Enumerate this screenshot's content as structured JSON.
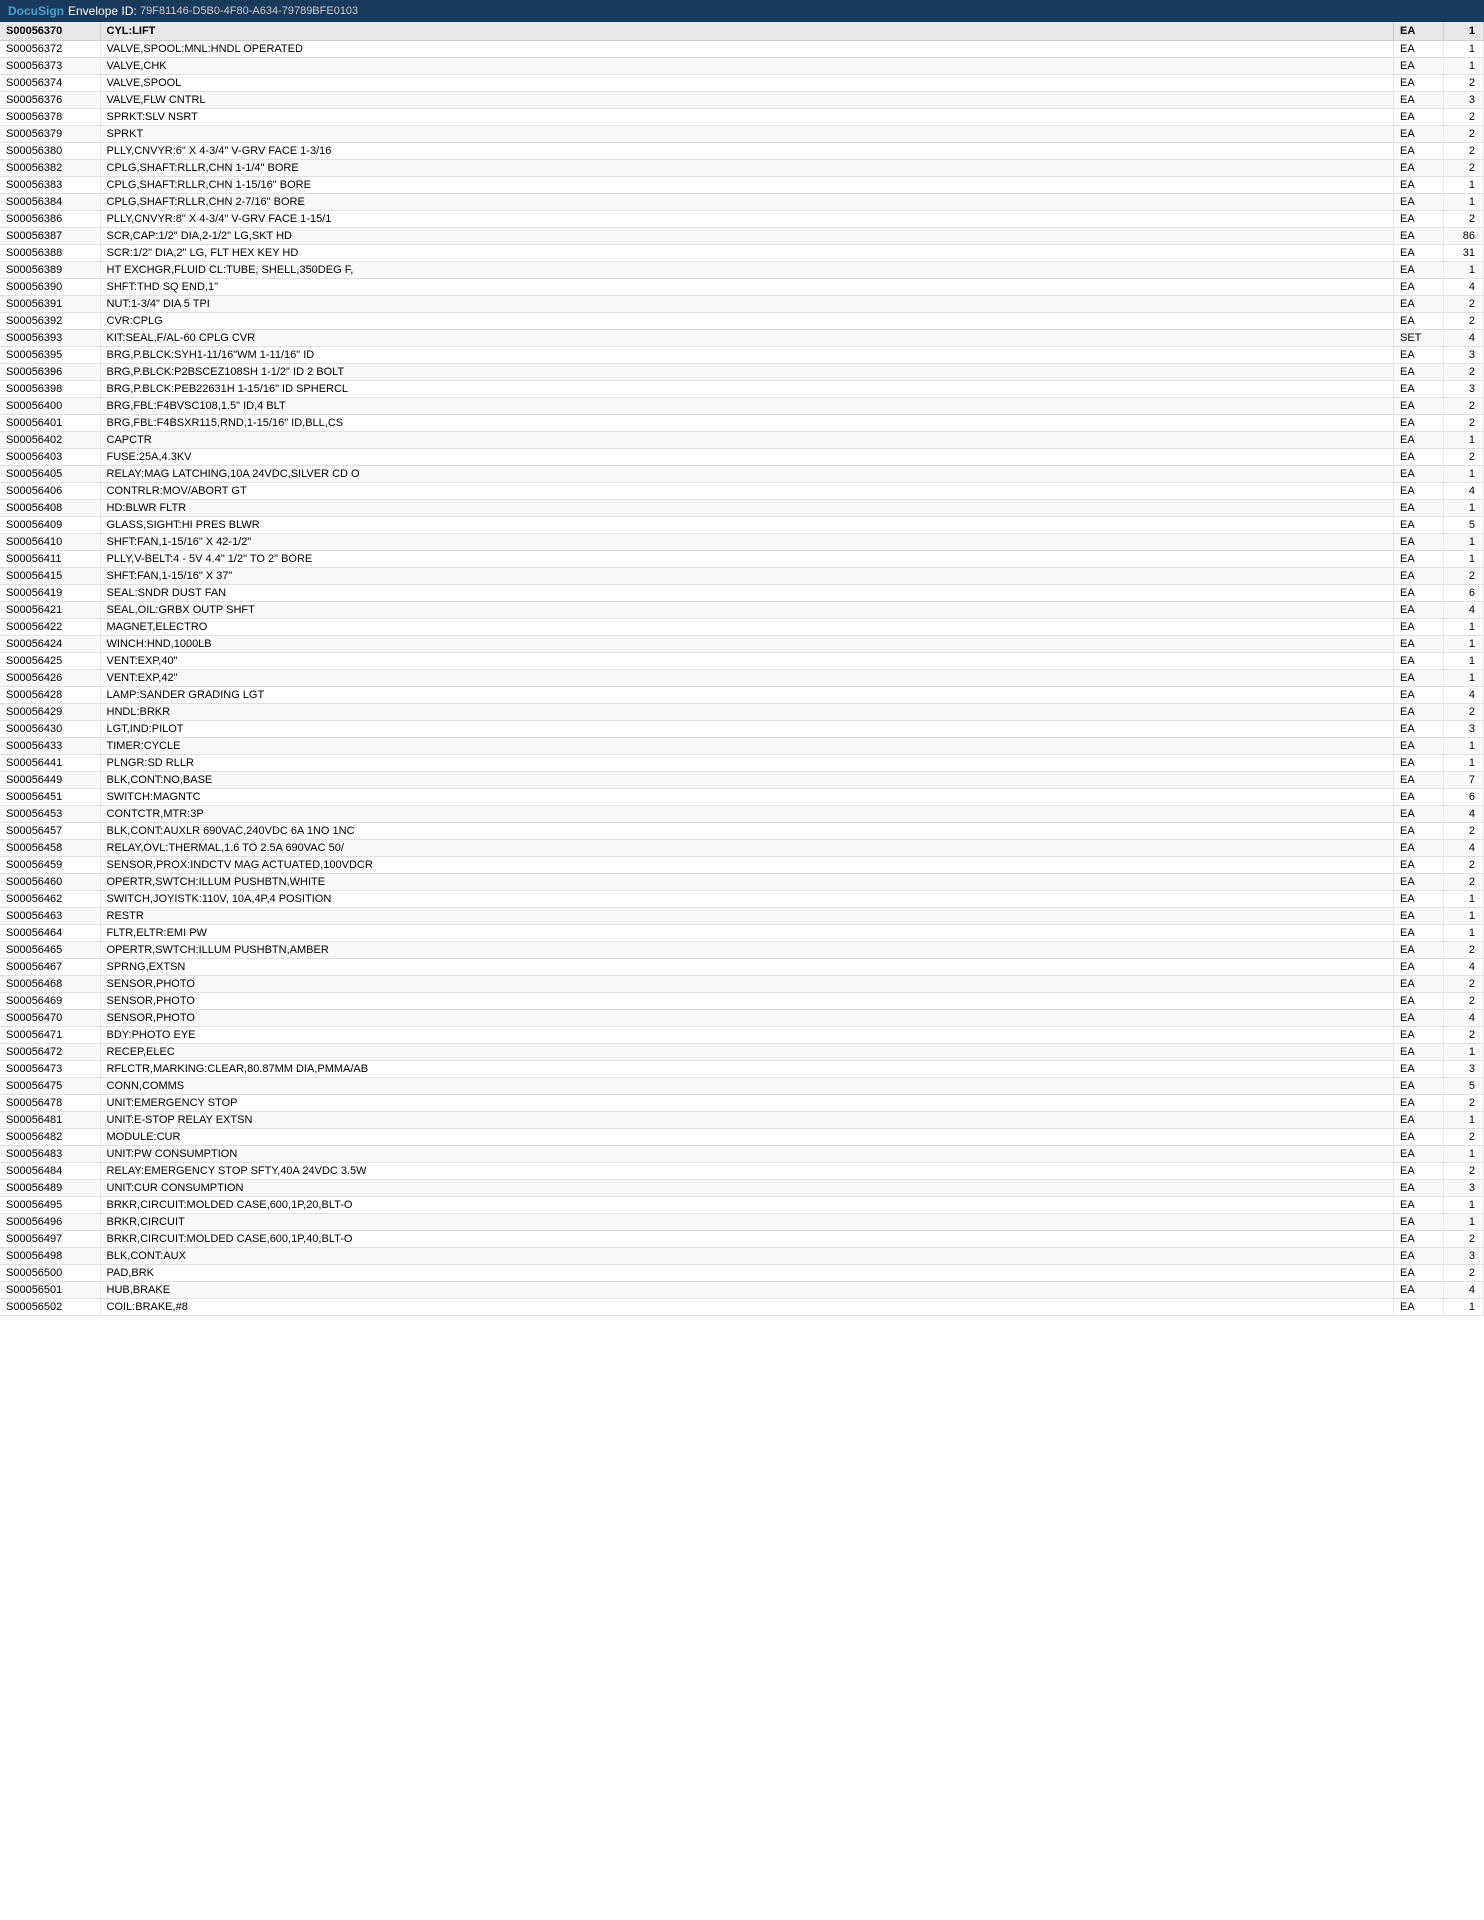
{
  "header": {
    "logo": "DocuSign",
    "envelope_label": "Envelope ID:",
    "envelope_id": "79F81146-D5B0-4F80-A634-79789BFE0103"
  },
  "table": {
    "columns": [
      {
        "key": "item",
        "label": "S00056370"
      },
      {
        "key": "description",
        "label": "CYL:LIFT"
      },
      {
        "key": "uom",
        "label": "EA"
      },
      {
        "key": "qty",
        "label": "1"
      }
    ],
    "rows": [
      {
        "item": "S00056372",
        "description": "VALVE,SPOOL:MNL:HNDL OPERATED",
        "uom": "EA",
        "qty": "1"
      },
      {
        "item": "S00056373",
        "description": "VALVE,CHK",
        "uom": "EA",
        "qty": "1"
      },
      {
        "item": "S00056374",
        "description": "VALVE,SPOOL",
        "uom": "EA",
        "qty": "2"
      },
      {
        "item": "S00056376",
        "description": "VALVE,FLW CNTRL",
        "uom": "EA",
        "qty": "3"
      },
      {
        "item": "S00056378",
        "description": "SPRKT:SLV NSRT",
        "uom": "EA",
        "qty": "2"
      },
      {
        "item": "S00056379",
        "description": "SPRKT",
        "uom": "EA",
        "qty": "2"
      },
      {
        "item": "S00056380",
        "description": "PLLY,CNVYR:6\" X 4-3/4\" V-GRV FACE 1-3/16",
        "uom": "EA",
        "qty": "2"
      },
      {
        "item": "S00056382",
        "description": "CPLG,SHAFT:RLLR,CHN 1-1/4\" BORE",
        "uom": "EA",
        "qty": "2"
      },
      {
        "item": "S00056383",
        "description": "CPLG,SHAFT:RLLR,CHN 1-15/16\" BORE",
        "uom": "EA",
        "qty": "1"
      },
      {
        "item": "S00056384",
        "description": "CPLG,SHAFT:RLLR,CHN 2-7/16\" BORE",
        "uom": "EA",
        "qty": "1"
      },
      {
        "item": "S00056386",
        "description": "PLLY,CNVYR:8\" X 4-3/4\" V-GRV FACE 1-15/1",
        "uom": "EA",
        "qty": "2"
      },
      {
        "item": "S00056387",
        "description": "SCR,CAP:1/2\" DIA,2-1/2\" LG,SKT HD",
        "uom": "EA",
        "qty": "86"
      },
      {
        "item": "S00056388",
        "description": "SCR:1/2\" DIA,2\" LG, FLT HEX KEY HD",
        "uom": "EA",
        "qty": "31"
      },
      {
        "item": "S00056389",
        "description": "HT EXCHGR,FLUID CL:TUBE, SHELL,350DEG F,",
        "uom": "EA",
        "qty": "1"
      },
      {
        "item": "S00056390",
        "description": "SHFT:THD SQ END,1\"",
        "uom": "EA",
        "qty": "4"
      },
      {
        "item": "S00056391",
        "description": "NUT:1-3/4\" DIA 5 TPI",
        "uom": "EA",
        "qty": "2"
      },
      {
        "item": "S00056392",
        "description": "CVR:CPLG",
        "uom": "EA",
        "qty": "2"
      },
      {
        "item": "S00056393",
        "description": "KIT:SEAL,F/AL-60 CPLG CVR",
        "uom": "SET",
        "qty": "4"
      },
      {
        "item": "S00056395",
        "description": "BRG,P.BLCK:SYH1-11/16\"WM 1-11/16\" ID",
        "uom": "EA",
        "qty": "3"
      },
      {
        "item": "S00056396",
        "description": "BRG,P.BLCK:P2BSCEZ108SH 1-1/2\" ID 2 BOLT",
        "uom": "EA",
        "qty": "2"
      },
      {
        "item": "S00056398",
        "description": "BRG,P.BLCK:PEB22631H 1-15/16\" ID SPHERCL",
        "uom": "EA",
        "qty": "3"
      },
      {
        "item": "S00056400",
        "description": "BRG,FBL:F4BVSC108,1.5\" ID,4 BLT",
        "uom": "EA",
        "qty": "2"
      },
      {
        "item": "S00056401",
        "description": "BRG,FBL:F4BSXR115,RND,1-15/16\" ID,BLL,CS",
        "uom": "EA",
        "qty": "2"
      },
      {
        "item": "S00056402",
        "description": "CAPCTR",
        "uom": "EA",
        "qty": "1"
      },
      {
        "item": "S00056403",
        "description": "FUSE:25A,4.3KV",
        "uom": "EA",
        "qty": "2"
      },
      {
        "item": "S00056405",
        "description": "RELAY:MAG LATCHING,10A 24VDC,SILVER CD O",
        "uom": "EA",
        "qty": "1"
      },
      {
        "item": "S00056406",
        "description": "CONTRLR:MOV/ABORT GT",
        "uom": "EA",
        "qty": "4"
      },
      {
        "item": "S00056408",
        "description": "HD:BLWR FLTR",
        "uom": "EA",
        "qty": "1"
      },
      {
        "item": "S00056409",
        "description": "GLASS,SIGHT:HI PRES BLWR",
        "uom": "EA",
        "qty": "5"
      },
      {
        "item": "S00056410",
        "description": "SHFT:FAN,1-15/16\" X 42-1/2\"",
        "uom": "EA",
        "qty": "1"
      },
      {
        "item": "S00056411",
        "description": "PLLY,V-BELT:4 - 5V 4.4\" 1/2\" TO 2\" BORE",
        "uom": "EA",
        "qty": "1"
      },
      {
        "item": "S00056415",
        "description": "SHFT:FAN,1-15/16\" X 37\"",
        "uom": "EA",
        "qty": "2"
      },
      {
        "item": "S00056419",
        "description": "SEAL:SNDR DUST FAN",
        "uom": "EA",
        "qty": "6"
      },
      {
        "item": "S00056421",
        "description": "SEAL,OIL:GRBX OUTP SHFT",
        "uom": "EA",
        "qty": "4"
      },
      {
        "item": "S00056422",
        "description": "MAGNET,ELECTRO",
        "uom": "EA",
        "qty": "1"
      },
      {
        "item": "S00056424",
        "description": "WINCH:HND,1000LB",
        "uom": "EA",
        "qty": "1"
      },
      {
        "item": "S00056425",
        "description": "VENT:EXP,40\"",
        "uom": "EA",
        "qty": "1"
      },
      {
        "item": "S00056426",
        "description": "VENT:EXP,42\"",
        "uom": "EA",
        "qty": "1"
      },
      {
        "item": "S00056428",
        "description": "LAMP:SANDER GRADING LGT",
        "uom": "EA",
        "qty": "4"
      },
      {
        "item": "S00056429",
        "description": "HNDL:BRKR",
        "uom": "EA",
        "qty": "2"
      },
      {
        "item": "S00056430",
        "description": "LGT,IND:PILOT",
        "uom": "EA",
        "qty": "3"
      },
      {
        "item": "S00056433",
        "description": "TIMER:CYCLE",
        "uom": "EA",
        "qty": "1"
      },
      {
        "item": "S00056441",
        "description": "PLNGR:SD RLLR",
        "uom": "EA",
        "qty": "1"
      },
      {
        "item": "S00056449",
        "description": "BLK,CONT:NO,BASE",
        "uom": "EA",
        "qty": "7"
      },
      {
        "item": "S00056451",
        "description": "SWITCH:MAGNTC",
        "uom": "EA",
        "qty": "6"
      },
      {
        "item": "S00056453",
        "description": "CONTCTR,MTR:3P",
        "uom": "EA",
        "qty": "4"
      },
      {
        "item": "S00056457",
        "description": "BLK,CONT:AUXLR 690VAC,240VDC 6A 1NO 1NC",
        "uom": "EA",
        "qty": "2"
      },
      {
        "item": "S00056458",
        "description": "RELAY,OVL:THERMAL,1.6 TO 2.5A 690VAC 50/",
        "uom": "EA",
        "qty": "4"
      },
      {
        "item": "S00056459",
        "description": "SENSOR,PROX:INDCTV MAG ACTUATED,100VDCR",
        "uom": "EA",
        "qty": "2"
      },
      {
        "item": "S00056460",
        "description": "OPERTR,SWTCH:ILLUM PUSHBTN,WHITE",
        "uom": "EA",
        "qty": "2"
      },
      {
        "item": "S00056462",
        "description": "SWITCH,JOYISTK:110V, 10A,4P,4 POSITION",
        "uom": "EA",
        "qty": "1"
      },
      {
        "item": "S00056463",
        "description": "RESTR",
        "uom": "EA",
        "qty": "1"
      },
      {
        "item": "S00056464",
        "description": "FLTR,ELTR:EMI PW",
        "uom": "EA",
        "qty": "1"
      },
      {
        "item": "S00056465",
        "description": "OPERTR,SWTCH:ILLUM PUSHBTN,AMBER",
        "uom": "EA",
        "qty": "2"
      },
      {
        "item": "S00056467",
        "description": "SPRNG,EXTSN",
        "uom": "EA",
        "qty": "4"
      },
      {
        "item": "S00056468",
        "description": "SENSOR,PHOTO",
        "uom": "EA",
        "qty": "2"
      },
      {
        "item": "S00056469",
        "description": "SENSOR,PHOTO",
        "uom": "EA",
        "qty": "2"
      },
      {
        "item": "S00056470",
        "description": "SENSOR,PHOTO",
        "uom": "EA",
        "qty": "4"
      },
      {
        "item": "S00056471",
        "description": "BDY:PHOTO EYE",
        "uom": "EA",
        "qty": "2"
      },
      {
        "item": "S00056472",
        "description": "RECEP,ELEC",
        "uom": "EA",
        "qty": "1"
      },
      {
        "item": "S00056473",
        "description": "RFLCTR,MARKING:CLEAR,80.87MM DIA,PMMA/AB",
        "uom": "EA",
        "qty": "3"
      },
      {
        "item": "S00056475",
        "description": "CONN,COMMS",
        "uom": "EA",
        "qty": "5"
      },
      {
        "item": "S00056478",
        "description": "UNIT:EMERGENCY STOP",
        "uom": "EA",
        "qty": "2"
      },
      {
        "item": "S00056481",
        "description": "UNIT:E-STOP RELAY EXTSN",
        "uom": "EA",
        "qty": "1"
      },
      {
        "item": "S00056482",
        "description": "MODULE:CUR",
        "uom": "EA",
        "qty": "2"
      },
      {
        "item": "S00056483",
        "description": "UNIT:PW CONSUMPTION",
        "uom": "EA",
        "qty": "1"
      },
      {
        "item": "S00056484",
        "description": "RELAY:EMERGENCY STOP SFTY,40A 24VDC 3.5W",
        "uom": "EA",
        "qty": "2"
      },
      {
        "item": "S00056489",
        "description": "UNIT:CUR CONSUMPTION",
        "uom": "EA",
        "qty": "3"
      },
      {
        "item": "S00056495",
        "description": "BRKR,CIRCUIT:MOLDED CASE,600,1P,20,BLT-O",
        "uom": "EA",
        "qty": "1"
      },
      {
        "item": "S00056496",
        "description": "BRKR,CIRCUIT",
        "uom": "EA",
        "qty": "1"
      },
      {
        "item": "S00056497",
        "description": "BRKR,CIRCUIT:MOLDED CASE,600,1P,40,BLT-O",
        "uom": "EA",
        "qty": "2"
      },
      {
        "item": "S00056498",
        "description": "BLK,CONT:AUX",
        "uom": "EA",
        "qty": "3"
      },
      {
        "item": "S00056500",
        "description": "PAD,BRK",
        "uom": "EA",
        "qty": "2"
      },
      {
        "item": "S00056501",
        "description": "HUB,BRAKE",
        "uom": "EA",
        "qty": "4"
      },
      {
        "item": "S00056502",
        "description": "COIL:BRAKE,#8",
        "uom": "EA",
        "qty": "1"
      }
    ]
  }
}
